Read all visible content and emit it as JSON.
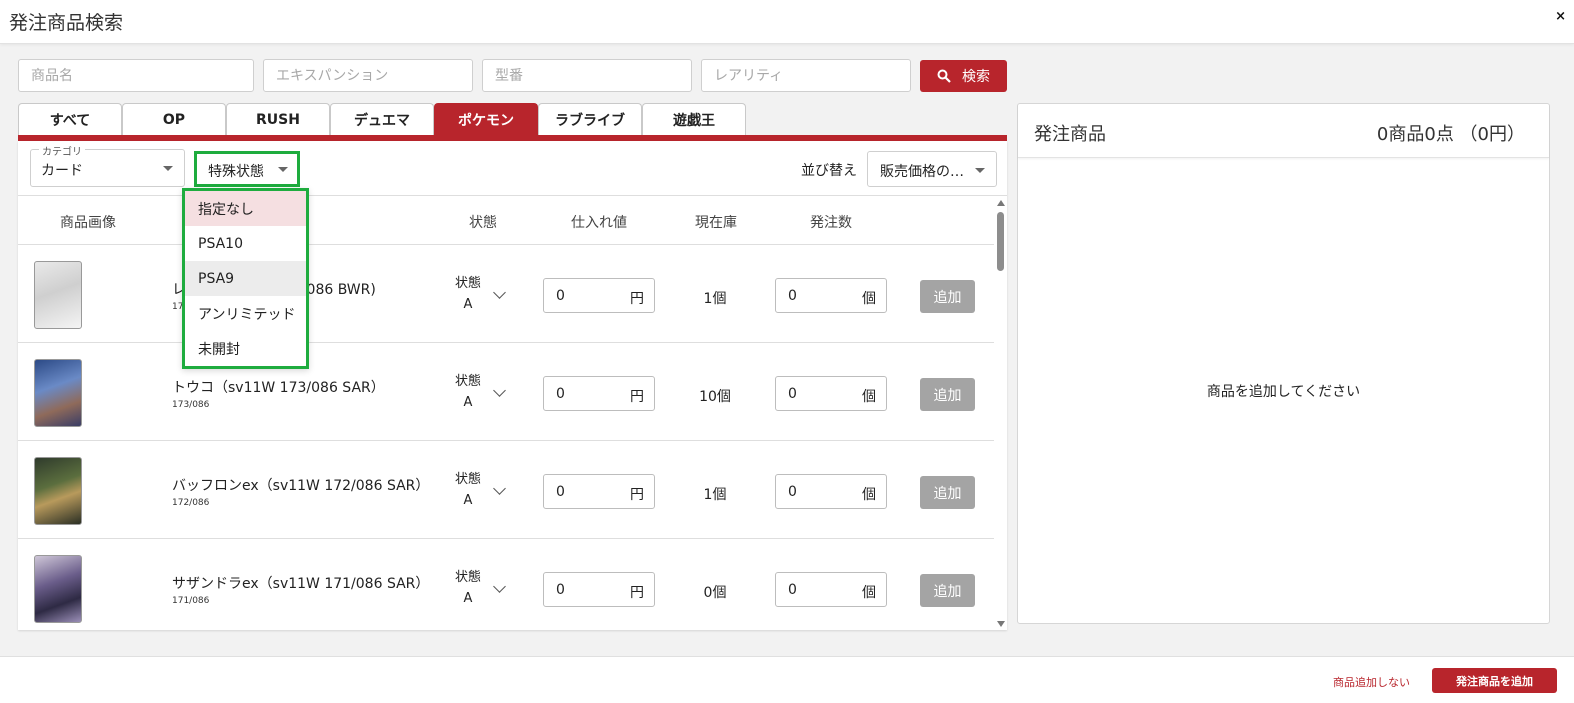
{
  "header": {
    "title": "発注商品検索",
    "close": "×"
  },
  "search": {
    "name_placeholder": "商品名",
    "expansion_placeholder": "エキスパンション",
    "model_placeholder": "型番",
    "rarity_placeholder": "レアリティ",
    "button_label": "検索"
  },
  "tabs": [
    "すべて",
    "OP",
    "RUSH",
    "デュエマ",
    "ポケモン",
    "ラブライブ",
    "遊戯王"
  ],
  "active_tab": "ポケモン",
  "filters": {
    "category_label": "カテゴリ",
    "category_value": "カード",
    "special_state_label": "特殊状態",
    "sort_label": "並び替え",
    "sort_value": "販売価格の…"
  },
  "special_state_options": [
    {
      "label": "指定なし",
      "state": "selected"
    },
    {
      "label": "PSA10",
      "state": "normal"
    },
    {
      "label": "PSA9",
      "state": "hover"
    },
    {
      "label": "アンリミテッド",
      "state": "normal"
    },
    {
      "label": "未開封",
      "state": "normal"
    }
  ],
  "table": {
    "columns": [
      "商品画像",
      "状態",
      "仕入れ値",
      "現在庫",
      "発注数"
    ],
    "add_label": "追加",
    "rows": [
      {
        "name": "レ　　　　　　　74/086 BWR)",
        "code": "17",
        "condition": "状態",
        "grade": "A",
        "cost": "0",
        "cost_unit": "円",
        "stock": "1個",
        "order": "0",
        "order_unit": "個"
      },
      {
        "name": "トウコ（sv11W 173/086 SAR）",
        "code": "173/086",
        "condition": "状態",
        "grade": "A",
        "cost": "0",
        "cost_unit": "円",
        "stock": "10個",
        "order": "0",
        "order_unit": "個"
      },
      {
        "name": "バッフロンex（sv11W 172/086 SAR）",
        "code": "172/086",
        "condition": "状態",
        "grade": "A",
        "cost": "0",
        "cost_unit": "円",
        "stock": "1個",
        "order": "0",
        "order_unit": "個"
      },
      {
        "name": "サザンドラex（sv11W 171/086 SAR）",
        "code": "171/086",
        "condition": "状態",
        "grade": "A",
        "cost": "0",
        "cost_unit": "円",
        "stock": "0個",
        "order": "0",
        "order_unit": "個"
      }
    ]
  },
  "order_panel": {
    "title": "発注商品",
    "summary": "0商品0点 （0円）",
    "empty_message": "商品を追加してください"
  },
  "footer": {
    "no_add_label": "商品追加しない",
    "submit_label": "発注商品を追加"
  },
  "colors": {
    "accent": "#b8252c",
    "highlight_outline": "#1eac3e",
    "disabled_button": "#a4a4a4"
  }
}
